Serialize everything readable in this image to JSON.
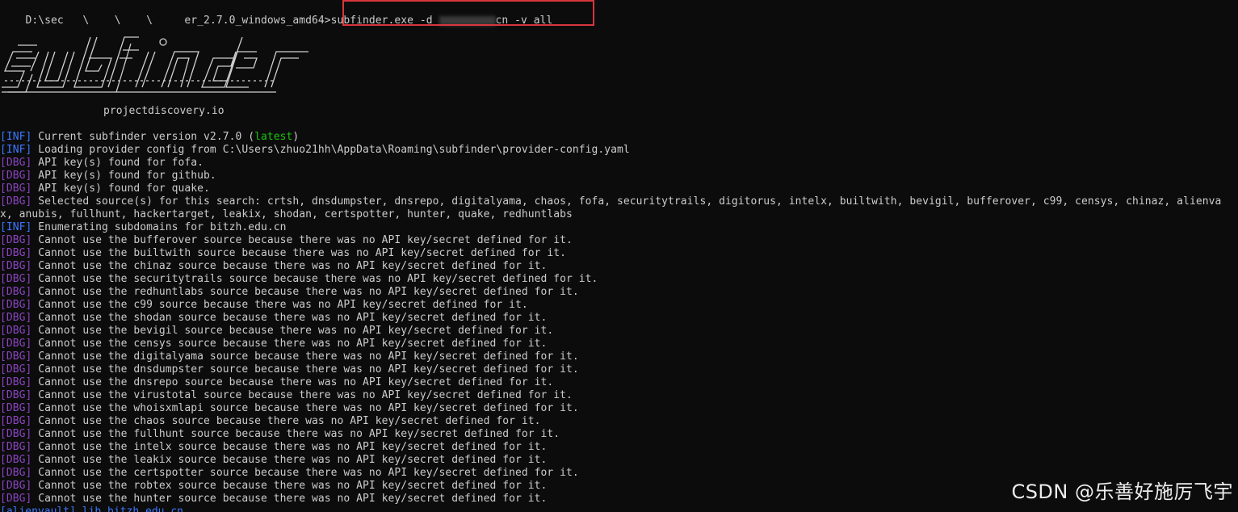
{
  "terminal": {
    "prompt": "D:\\sec   \\    \\    \\     er_2.7.0_windows_amd64>",
    "command": "subfinder.exe -d ",
    "command_suffix": "cn -v all",
    "brand": "projectdiscovery.io",
    "lines": [
      {
        "tag": "[INF]",
        "kind": "inf",
        "text": " Current subfinder version v2.7.0 (",
        "extra": "latest",
        "extra_kind": "green",
        "after": ")"
      },
      {
        "tag": "[INF]",
        "kind": "inf",
        "text": " Loading provider config from C:\\Users\\zhuo21hh\\AppData\\Roaming\\subfinder\\provider-config.yaml"
      },
      {
        "tag": "[DBG]",
        "kind": "dbg",
        "text": " API key(s) found for fofa."
      },
      {
        "tag": "[DBG]",
        "kind": "dbg",
        "text": " API key(s) found for github."
      },
      {
        "tag": "[DBG]",
        "kind": "dbg",
        "text": " API key(s) found for quake."
      },
      {
        "tag": "[DBG]",
        "kind": "dbg",
        "text": " Selected source(s) for this search: crtsh, dnsdumpster, dnsrepo, digitalyama, chaos, fofa, securitytrails, digitorus, intelx, builtwith, bevigil, bufferover, c99, censys, chinaz, alienva"
      },
      {
        "tag": "",
        "kind": "plain",
        "text": "x, anubis, fullhunt, hackertarget, leakix, shodan, certspotter, hunter, quake, redhuntlabs"
      },
      {
        "tag": "[INF]",
        "kind": "inf",
        "text": " Enumerating subdomains for bitzh.edu.cn"
      },
      {
        "tag": "[DBG]",
        "kind": "dbg",
        "text": " Cannot use the bufferover source because there was no API key/secret defined for it."
      },
      {
        "tag": "[DBG]",
        "kind": "dbg",
        "text": " Cannot use the builtwith source because there was no API key/secret defined for it."
      },
      {
        "tag": "[DBG]",
        "kind": "dbg",
        "text": " Cannot use the chinaz source because there was no API key/secret defined for it."
      },
      {
        "tag": "[DBG]",
        "kind": "dbg",
        "text": " Cannot use the securitytrails source because there was no API key/secret defined for it."
      },
      {
        "tag": "[DBG]",
        "kind": "dbg",
        "text": " Cannot use the redhuntlabs source because there was no API key/secret defined for it."
      },
      {
        "tag": "[DBG]",
        "kind": "dbg",
        "text": " Cannot use the c99 source because there was no API key/secret defined for it."
      },
      {
        "tag": "[DBG]",
        "kind": "dbg",
        "text": " Cannot use the shodan source because there was no API key/secret defined for it."
      },
      {
        "tag": "[DBG]",
        "kind": "dbg",
        "text": " Cannot use the bevigil source because there was no API key/secret defined for it."
      },
      {
        "tag": "[DBG]",
        "kind": "dbg",
        "text": " Cannot use the censys source because there was no API key/secret defined for it."
      },
      {
        "tag": "[DBG]",
        "kind": "dbg",
        "text": " Cannot use the digitalyama source because there was no API key/secret defined for it."
      },
      {
        "tag": "[DBG]",
        "kind": "dbg",
        "text": " Cannot use the dnsdumpster source because there was no API key/secret defined for it."
      },
      {
        "tag": "[DBG]",
        "kind": "dbg",
        "text": " Cannot use the dnsrepo source because there was no API key/secret defined for it."
      },
      {
        "tag": "[DBG]",
        "kind": "dbg",
        "text": " Cannot use the virustotal source because there was no API key/secret defined for it."
      },
      {
        "tag": "[DBG]",
        "kind": "dbg",
        "text": " Cannot use the whoisxmlapi source because there was no API key/secret defined for it."
      },
      {
        "tag": "[DBG]",
        "kind": "dbg",
        "text": " Cannot use the chaos source because there was no API key/secret defined for it."
      },
      {
        "tag": "[DBG]",
        "kind": "dbg",
        "text": " Cannot use the fullhunt source because there was no API key/secret defined for it."
      },
      {
        "tag": "[DBG]",
        "kind": "dbg",
        "text": " Cannot use the intelx source because there was no API key/secret defined for it."
      },
      {
        "tag": "[DBG]",
        "kind": "dbg",
        "text": " Cannot use the leakix source because there was no API key/secret defined for it."
      },
      {
        "tag": "[DBG]",
        "kind": "dbg",
        "text": " Cannot use the certspotter source because there was no API key/secret defined for it."
      },
      {
        "tag": "[DBG]",
        "kind": "dbg",
        "text": " Cannot use the robtex source because there was no API key/secret defined for it."
      },
      {
        "tag": "[DBG]",
        "kind": "dbg",
        "text": " Cannot use the hunter source because there was no API key/secret defined for it."
      }
    ],
    "bottom_partial": "[alienvault] lib.bitzh.edu.cn"
  },
  "watermark": "CSDN @乐善好施厉飞宇",
  "colors": {
    "background": "#0c0c0c",
    "text": "#cccccc",
    "inf": "#3b78ff",
    "dbg": "#8a44c0",
    "green": "#16c60c",
    "highlight_box": "#d9363e"
  }
}
